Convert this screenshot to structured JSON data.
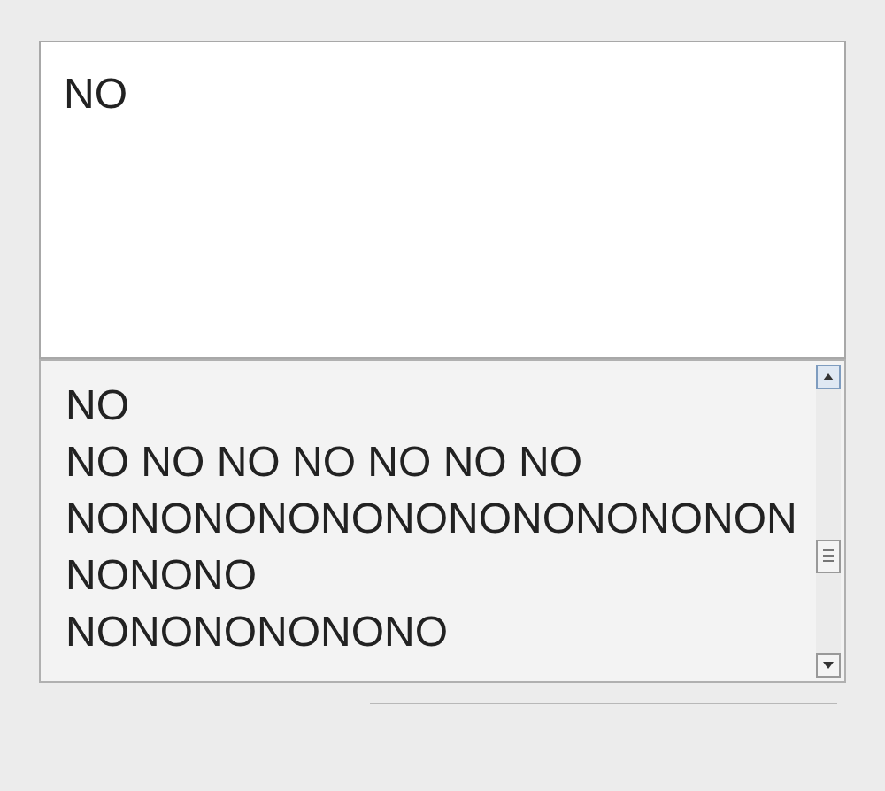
{
  "text_area": {
    "value": "NO"
  },
  "list": {
    "items": [
      {
        "label": "NO"
      },
      {
        "label": "NO NO NO NO NO NO NO"
      },
      {
        "label": "NONONONONONONONONONONON"
      },
      {
        "label": "NONONO"
      },
      {
        "label": "NONONONONONO"
      }
    ]
  }
}
